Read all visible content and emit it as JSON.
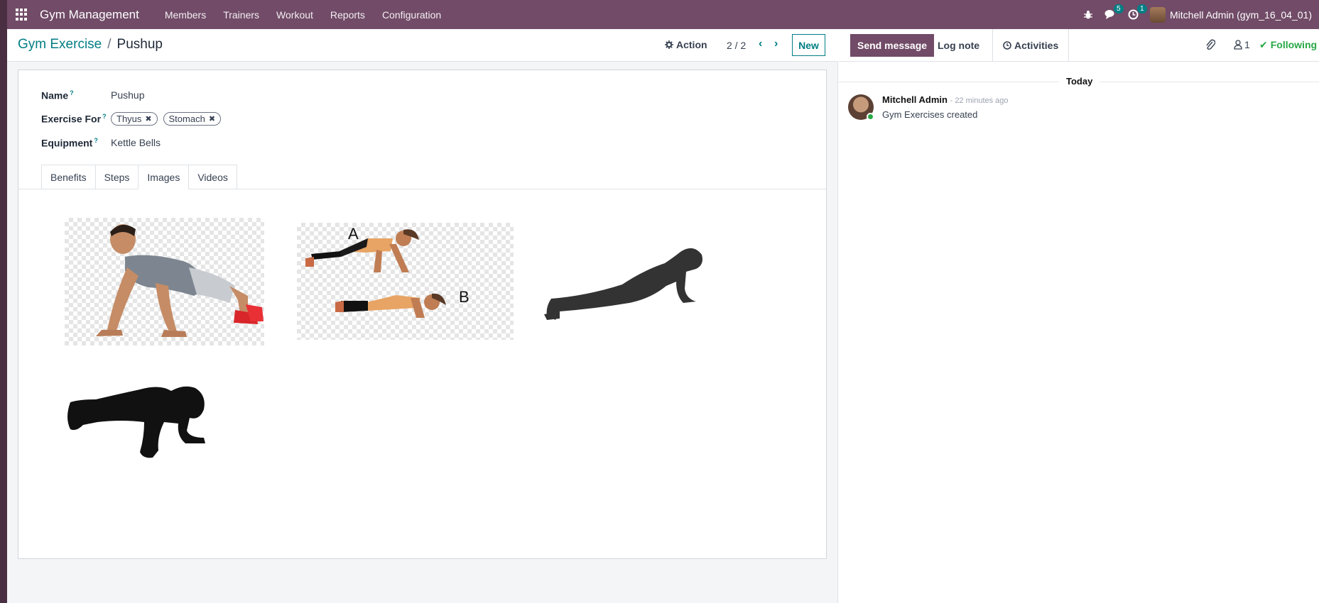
{
  "navbar": {
    "app_name": "Gym Management",
    "menu": [
      "Members",
      "Trainers",
      "Workout",
      "Reports",
      "Configuration"
    ],
    "messages_count": "5",
    "activities_count": "1",
    "user": "Mitchell Admin (gym_16_04_01)"
  },
  "control_panel": {
    "breadcrumb_parent": "Gym Exercise",
    "breadcrumb_sep": "/",
    "breadcrumb_current": "Pushup",
    "action_label": "Action",
    "pager": "2 / 2",
    "new_label": "New"
  },
  "form": {
    "name_label": "Name",
    "name_value": "Pushup",
    "exercise_for_label": "Exercise For",
    "exercise_for_tags": [
      "Thyus",
      "Stomach"
    ],
    "equipment_label": "Equipment",
    "equipment_value": "Kettle Bells",
    "help_mark": "?",
    "tabs": [
      "Benefits",
      "Steps",
      "Images",
      "Videos"
    ],
    "active_tab": "Images",
    "image_labels": [
      "A",
      "B"
    ]
  },
  "chatter": {
    "send_message": "Send message",
    "log_note": "Log note",
    "activities": "Activities",
    "followers_count": "1",
    "following": "Following",
    "date_separator": "Today",
    "message": {
      "author": "Mitchell Admin",
      "time": "- 22 minutes ago",
      "body": "Gym Exercises created"
    }
  },
  "colors": {
    "brand": "#714b67",
    "accent": "#017e84",
    "following": "#28a745"
  }
}
